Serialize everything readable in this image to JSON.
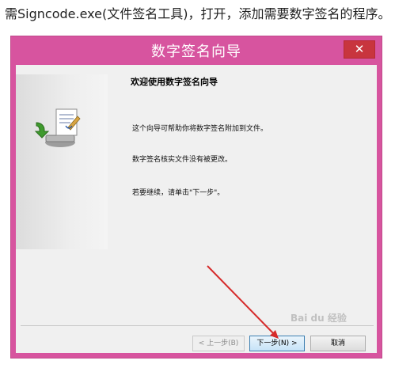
{
  "caption": "需Signcode.exe(文件签名工具)，打开，添加需要数字签名的程序。",
  "window": {
    "title": "数字签名向导",
    "close_glyph": "✕"
  },
  "content": {
    "heading": "欢迎使用数字签名向导",
    "line1": "这个向导可帮助你将数字签名附加到文件。",
    "line2": "数字签名核实文件没有被更改。",
    "line3": "若要继续，请单击\"下一步\"。"
  },
  "buttons": {
    "back": "< 上一步(B)",
    "next": "下一步(N) >",
    "cancel": "取消"
  },
  "watermark": "Bai du 经验",
  "colors": {
    "titlebar": "#d7549f",
    "close": "#c8353e",
    "arrow": "#d62b2b"
  },
  "icons": [
    "document-certificate-icon",
    "install-arrow-icon"
  ]
}
